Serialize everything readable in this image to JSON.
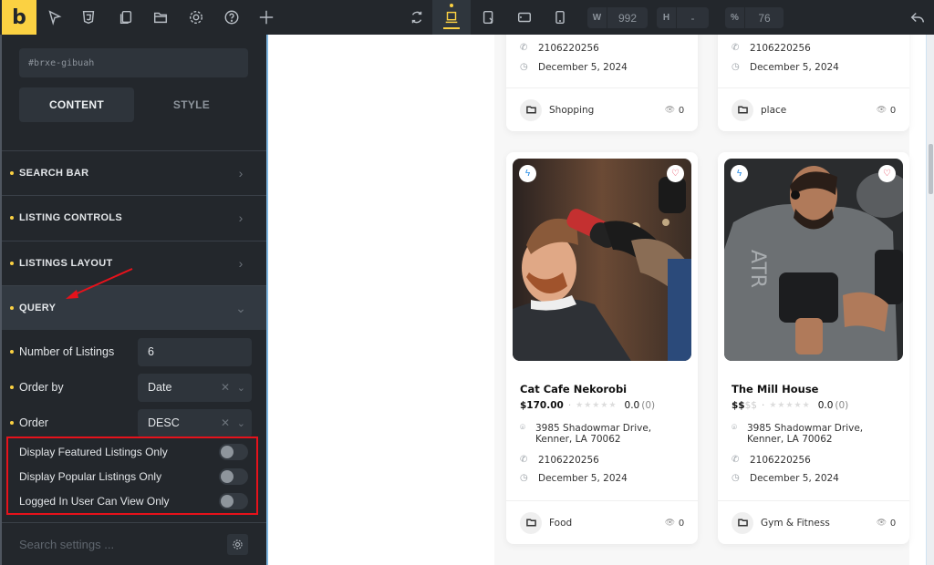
{
  "topbar": {
    "logo": "b",
    "left_icons": [
      "select-icon",
      "css3-icon",
      "pages-icon",
      "folder-icon",
      "settings-icon",
      "help-icon",
      "add-icon"
    ],
    "breakpoints": [
      "refresh-icon",
      "laptop-icon",
      "tablet-landscape-icon",
      "tablet-portrait-icon",
      "mobile-icon"
    ],
    "active_breakpoint": "laptop-icon",
    "width_label": "W",
    "width_value": "992",
    "height_label": "H",
    "height_value": "-",
    "zoom_label": "%",
    "zoom_value": "76",
    "undo_icon": "undo-icon"
  },
  "panel": {
    "element_id": "#brxe-gibuah",
    "tabs": [
      {
        "label": "CONTENT",
        "active": true
      },
      {
        "label": "STYLE",
        "active": false
      }
    ],
    "sections": [
      {
        "label": "SEARCH BAR",
        "open": false
      },
      {
        "label": "LISTING CONTROLS",
        "open": false
      },
      {
        "label": "LISTINGS LAYOUT",
        "open": false
      },
      {
        "label": "QUERY",
        "open": true
      }
    ],
    "query_controls": [
      {
        "label": "Number of Listings",
        "value": "6"
      },
      {
        "label": "Order by",
        "value": "Date"
      },
      {
        "label": "Order",
        "value": "DESC"
      }
    ],
    "toggles": [
      {
        "label": "Display Featured Listings Only",
        "on": false
      },
      {
        "label": "Display Popular Listings Only",
        "on": false
      },
      {
        "label": "Logged In User Can View Only",
        "on": false
      }
    ],
    "search_placeholder": "Search settings ..."
  },
  "canvas": {
    "top_cards": [
      {
        "phone": "2106220256",
        "date": "December 5, 2024",
        "category": "Shopping",
        "views": "0"
      },
      {
        "phone": "2106220256",
        "date": "December 5, 2024",
        "category": "place",
        "views": "0"
      }
    ],
    "cards": [
      {
        "title": "Cat Cafe Nekorobi",
        "price": "$170.00",
        "price_dim": "",
        "rating": "0.0",
        "rating_count": "(0)",
        "address": "3985 Shadowmar Drive, Kenner, LA 70062",
        "phone": "2106220256",
        "date": "December 5, 2024",
        "category": "Food",
        "views": "0",
        "image": "barber-photo"
      },
      {
        "title": "The Mill House",
        "price": "$$",
        "price_dim": "$$",
        "rating": "0.0",
        "rating_count": "(0)",
        "address": "3985 Shadowmar Drive, Kenner, LA 70062",
        "phone": "2106220256",
        "date": "December 5, 2024",
        "category": "Gym & Fitness",
        "views": "0",
        "image": "gym-photo"
      }
    ],
    "stars": "★★★★★",
    "separator": "·"
  },
  "colors": {
    "accent": "#fbd142",
    "panel_bg": "#23272c",
    "highlight_border": "#e6121b",
    "annotation_arrow": "#e6121b",
    "badge_blue": "#1e88e5",
    "heart_red": "#e53950"
  }
}
